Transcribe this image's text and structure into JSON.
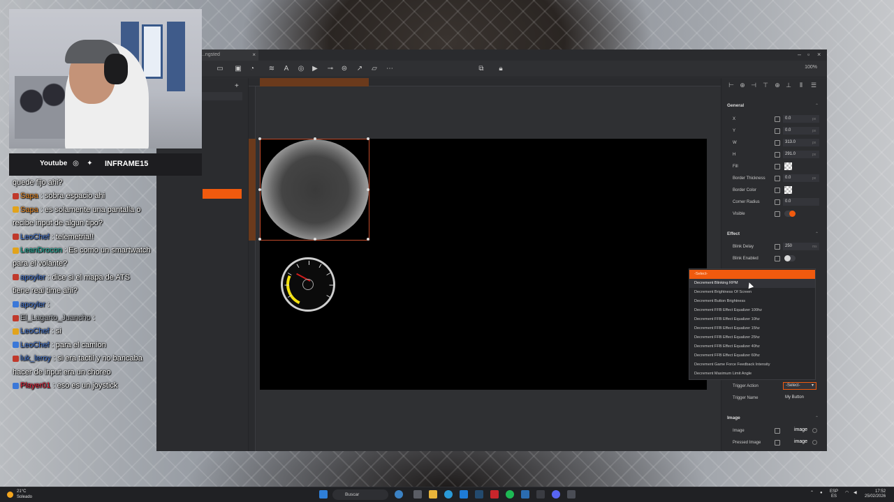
{
  "app": {
    "tab_title": "...ngsted",
    "tab_close": "×",
    "zoom": "100%"
  },
  "toolbar": {
    "tools": [
      "rectangle-tool-icon",
      "image-tool-icon",
      "gauge-tool-icon",
      "layer-tool-icon",
      "text-tool-icon",
      "target-tool-icon",
      "video-tool-icon",
      "slider-tool-icon",
      "dial-tool-icon",
      "chart-tool-icon",
      "folder-tool-icon",
      "more-tool-icon",
      "grid-tool-icon",
      "lock-icon"
    ]
  },
  "left_panel": {
    "add": "+"
  },
  "properties": {
    "general": {
      "title": "General",
      "x": {
        "label": "X",
        "value": "0.0",
        "unit": "px"
      },
      "y": {
        "label": "Y",
        "value": "0.0",
        "unit": "px"
      },
      "w": {
        "label": "W",
        "value": "313.0",
        "unit": "px"
      },
      "h": {
        "label": "H",
        "value": "291.0",
        "unit": "px"
      },
      "fill": {
        "label": "Fill"
      },
      "border_thickness": {
        "label": "Border Thickness",
        "value": "0.0",
        "unit": "px"
      },
      "border_color": {
        "label": "Border Color"
      },
      "corner_radius": {
        "label": "Corner Radius",
        "value": "0.0"
      },
      "visible": {
        "label": "Visible",
        "on": true
      }
    },
    "effect": {
      "title": "Effect",
      "blink_delay": {
        "label": "Blink Delay",
        "value": "250",
        "unit": "ms"
      },
      "blink_enabled": {
        "label": "Blink Enabled",
        "on": false
      }
    },
    "trigger": {
      "action_label": "Trigger Action",
      "action_value": "-Select-",
      "name_label": "Trigger Name",
      "name_value": "My Button"
    },
    "image": {
      "title": "Image",
      "image_label": "Image",
      "image_value": "image",
      "pressed_label": "Pressed Image",
      "pressed_value": "image"
    }
  },
  "dropdown": {
    "options": [
      "-Select-",
      "Decrement Blinking RPM",
      "Decrement Brightness Of Screen",
      "Decrement Button  Brightness",
      "Decrement FFB Effect Equalizer 100hz",
      "Decrement FFB Effect Equalizer 10hz",
      "Decrement FFB Effect Equalizer 15hz",
      "Decrement FFB Effect Equalizer 25hz",
      "Decrement FFB Effect Equalizer 40hz",
      "Decrement FFB Effect Equalizer 60hz",
      "Decrement Game Force Feedback Intensity",
      "Decrement Maximum Limit Angle"
    ],
    "selected_index": 0,
    "hover_index": 1
  },
  "stream": {
    "youtube": "Youtube",
    "handle": "INFRAME15"
  },
  "chat": [
    {
      "user": "",
      "message": "quede fijo ahi?",
      "color": ""
    },
    {
      "user": "Sapa",
      "message": ": sobra espacio ahi",
      "color": "orange"
    },
    {
      "user": "Sapa",
      "message": ": es solamente una pantalla o",
      "color": "orange"
    },
    {
      "user": "",
      "message": "recibe input de algun tipo?",
      "color": ""
    },
    {
      "user": "LeoChef",
      "message": ": telemetria!!",
      "color": "blue"
    },
    {
      "user": "LeanDrocon",
      "message": ": Es como un smartwatch",
      "color": "teal"
    },
    {
      "user": "",
      "message": "para el volante?",
      "color": ""
    },
    {
      "user": "apoyler",
      "message": ": dice si el mapa de ATS",
      "color": "blue"
    },
    {
      "user": "",
      "message": "tiene real time ahi?",
      "color": ""
    },
    {
      "user": "apoyler",
      "message": ":",
      "color": "blue"
    },
    {
      "user": "El_Lagarto_Juancho",
      "message": ":",
      "color": "grey"
    },
    {
      "user": "LeoChef",
      "message": ": si",
      "color": "blue"
    },
    {
      "user": "LeoChef",
      "message": ": para el camion",
      "color": "blue"
    },
    {
      "user": "luk_leroy",
      "message": ": si era tactil y no bancaba",
      "color": "blue"
    },
    {
      "user": "",
      "message": "hacer de input era un choreo",
      "color": ""
    },
    {
      "user": "Player01",
      "message": ": eso es un joystick",
      "color": "red"
    }
  ],
  "taskbar": {
    "temp": "21°C",
    "weather": "Soleado",
    "search": "Buscar",
    "lang1": "ESP",
    "lang2": "ES",
    "time": "17:52",
    "date": "25/02/2026"
  },
  "colors": {
    "accent": "#f05a0e",
    "panel": "#2b2c2f",
    "canvas": "#000000"
  }
}
